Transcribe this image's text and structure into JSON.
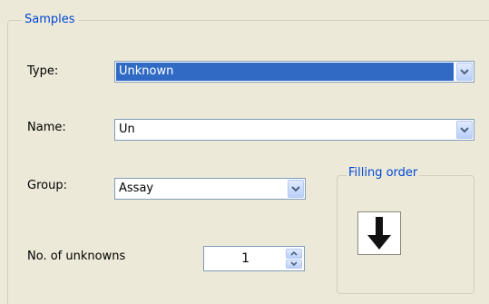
{
  "samples": {
    "title": "Samples",
    "type": {
      "label": "Type:",
      "value": "Unknown"
    },
    "name": {
      "label": "Name:",
      "value": "Un"
    },
    "group": {
      "label": "Group:",
      "value": "Assay"
    },
    "unknowns": {
      "label": "No. of unknowns",
      "value": "1"
    }
  },
  "filling_order": {
    "title": "Filling order",
    "icon": "arrow-down-icon"
  },
  "colors": {
    "selection": "#316ac5",
    "group_title": "#0046d5",
    "background": "#ece9d8"
  }
}
